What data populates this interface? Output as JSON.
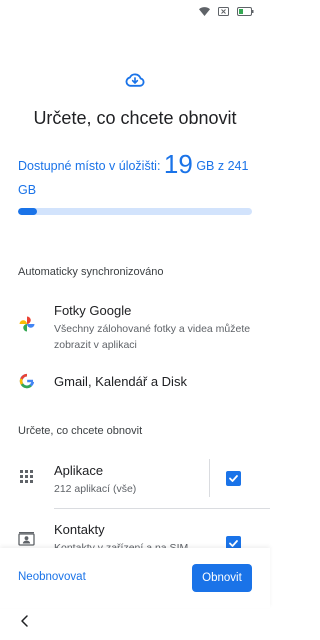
{
  "colors": {
    "accent": "#1a73e8",
    "progress_track": "#d2e3fc"
  },
  "status_bar": {
    "icons": [
      "wifi-icon",
      "no-sim-icon",
      "battery-icon"
    ]
  },
  "header": {
    "icon": "cloud-download-icon",
    "title": "Určete, co chcete obnovit"
  },
  "storage": {
    "prefix": "Dostupné místo v úložišti:",
    "free_value": "19",
    "suffix": "GB z 241 GB",
    "free_gb": 19,
    "total_gb": 241,
    "used_fraction": 0.08
  },
  "auto_sync": {
    "label": "Automaticky synchronizováno",
    "items": [
      {
        "icon": "google-photos-icon",
        "title": "Fotky Google",
        "subtitle": "Všechny zálohované fotky a videa můžete zobrazit v aplikaci"
      },
      {
        "icon": "google-g-icon",
        "title": "Gmail, Kalendář a Disk"
      }
    ]
  },
  "restore": {
    "label": "Určete, co chcete obnovit",
    "items": [
      {
        "icon": "apps-grid-icon",
        "title": "Aplikace",
        "subtitle": "212 aplikací (vše)",
        "checked": true
      },
      {
        "icon": "contacts-icon",
        "title": "Kontakty",
        "subtitle": "Kontakty v zařízení a na SIM",
        "checked": true
      }
    ]
  },
  "footer": {
    "skip_label": "Neobnovovat",
    "restore_label": "Obnovit"
  },
  "nav": {
    "back_icon": "back-chevron-icon"
  }
}
